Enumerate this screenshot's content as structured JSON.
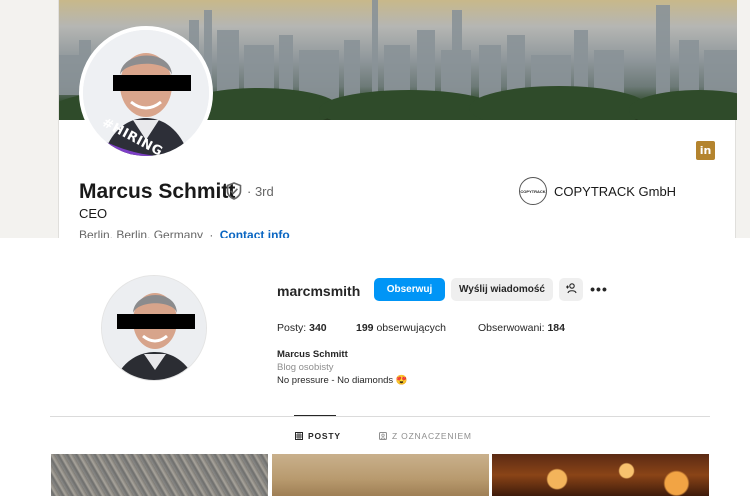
{
  "linkedin": {
    "hiring_badge": "#HIRING",
    "name": "Marcus Schmitt",
    "degree": "· 3rd",
    "headline": "CEO",
    "location": "Berlin, Berlin, Germany",
    "location_separator": "·",
    "contact_info_label": "Contact info",
    "company_name": "COPYTRACK GmbH",
    "company_logo_text": "COPYTRACK",
    "logo_text": "in",
    "colors": {
      "accent": "#0a66c2",
      "hiring_purple": "#7d3fc6",
      "linkedin_logo_bg": "#b4842e"
    },
    "icons": [
      "verified-shield-icon",
      "linkedin-logo-icon"
    ]
  },
  "instagram": {
    "username": "marcmsmith",
    "follow_label": "Obserwuj",
    "message_label": "Wyślij wiadomość",
    "more_label": "•••",
    "stats": {
      "posts_label": "Posty:",
      "posts_value": "340",
      "followers_value": "199",
      "followers_label": "obserwujących",
      "following_label": "Obserwowani:",
      "following_value": "184"
    },
    "full_name": "Marcus Schmitt",
    "category": "Blog osobisty",
    "bio": "No pressure - No diamonds 😍",
    "tabs": [
      {
        "label": "POSTY",
        "icon": "grid-icon",
        "active": true
      },
      {
        "label": "Z OZNACZENIEM",
        "icon": "tagged-icon",
        "active": false
      }
    ],
    "colors": {
      "follow_button": "#0095f6",
      "secondary_button": "#efefef",
      "muted_text": "#8e8e8e"
    },
    "icons": [
      "add-person-icon",
      "more-options-icon",
      "grid-icon",
      "tagged-icon"
    ]
  }
}
